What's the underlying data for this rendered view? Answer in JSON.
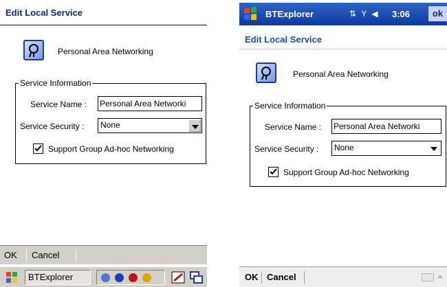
{
  "left": {
    "dialog_title": "Edit Local Service",
    "service_display_name": "Personal Area Networking",
    "group_title": "Service Information",
    "service_name_label": "Service Name :",
    "service_name_value": "Personal Area Networki",
    "service_security_label": "Service Security :",
    "service_security_value": "None",
    "adhoc_label": "Support Group Ad-hoc Networking",
    "adhoc_checked": true,
    "menu": {
      "ok": "OK",
      "cancel": "Cancel"
    },
    "taskbar": {
      "app_name": "BTExplorer",
      "icons": [
        "windows-start-icon",
        "bluetooth-icon",
        "network-icon",
        "battery-icon",
        "pen-icon",
        "windows-switch-icon"
      ]
    }
  },
  "right": {
    "app_title": "BTExplorer",
    "clock": "3:06",
    "ok_button": "ok",
    "status_icons": [
      "connectivity-icon",
      "signal-icon",
      "volume-icon"
    ],
    "dialog_title": "Edit Local Service",
    "service_display_name": "Personal Area Networking",
    "group_title": "Service Information",
    "service_name_label": "Service Name :",
    "service_name_value": "Personal Area Networki",
    "service_security_label": "Service Security :",
    "service_security_value": "None",
    "adhoc_label": "Support Group Ad-hoc Networking",
    "adhoc_checked": true,
    "menu": {
      "ok": "OK",
      "cancel": "Cancel"
    }
  },
  "colors": {
    "title_blue": "#0a2a7a",
    "topbar_blue": "#1c4aa8",
    "menubar_gray": "#d4d0c8"
  }
}
